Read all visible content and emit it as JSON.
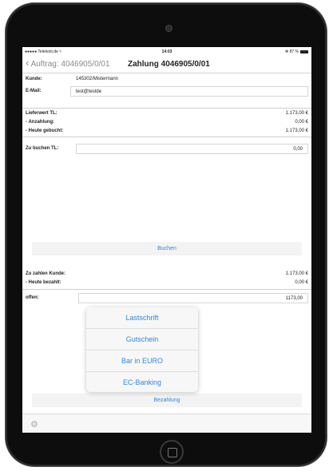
{
  "status_bar": {
    "carrier": "●●●●● Telekom.de ≈",
    "time": "14:03",
    "battery": "✻ 87 %"
  },
  "nav": {
    "back_label": "Auftrag: 4046905/0/01",
    "title": "Zahlung 4046905/0/01"
  },
  "customer": {
    "kunde_label": "Kunde:",
    "kunde_value": "145302/Mistermann",
    "email_label": "E-Mail:",
    "email_value": "test@testde"
  },
  "summary": [
    {
      "label": "Lieferwert TL:",
      "value": "1.173,00 €"
    },
    {
      "label": "- Anzahlung:",
      "value": "0,00 €"
    },
    {
      "label": "- Heute gebucht:",
      "value": "1.173,00 €"
    }
  ],
  "zubuchen": {
    "label": "Zu buchen TL:",
    "value": "0,00"
  },
  "buchen_button": "Buchen",
  "payment": [
    {
      "label": "Zu zahlen Kunde:",
      "value": "1.173,00 €"
    },
    {
      "label": "- Heute bezahlt:",
      "value": "0,00 €"
    }
  ],
  "offen": {
    "label": "offen:",
    "value": "1173,00"
  },
  "payment_options": [
    "Lastschrift",
    "Gutschein",
    "Bar in EURO",
    "EC-Banking"
  ],
  "bezahlung_button": "Bezahlung",
  "icons": {
    "back": "chevron-left-icon",
    "settings": "gear-icon",
    "battery": "battery-icon"
  },
  "colors": {
    "accent": "#2f86e0"
  }
}
